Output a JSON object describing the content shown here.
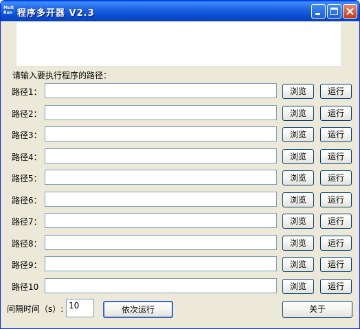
{
  "window": {
    "title": "程序多开器 V2.3",
    "icon_text_top": "Mult",
    "icon_text_bottom": "Run"
  },
  "form": {
    "prompt": "请输入要执行程序的路径：",
    "rows": [
      {
        "label": "路径1：",
        "value": ""
      },
      {
        "label": "路径2：",
        "value": ""
      },
      {
        "label": "路径3：",
        "value": ""
      },
      {
        "label": "路径4：",
        "value": ""
      },
      {
        "label": "路径5：",
        "value": ""
      },
      {
        "label": "路径6：",
        "value": ""
      },
      {
        "label": "路径7：",
        "value": ""
      },
      {
        "label": "路径8：",
        "value": ""
      },
      {
        "label": "路径9：",
        "value": ""
      },
      {
        "label": "路径10",
        "value": ""
      }
    ],
    "browse_label": "浏览",
    "run_label": "运行",
    "interval_label": "间隔时间（s）:",
    "interval_value": "10",
    "sequential_run_label": "依次运行",
    "about_label": "关于"
  }
}
